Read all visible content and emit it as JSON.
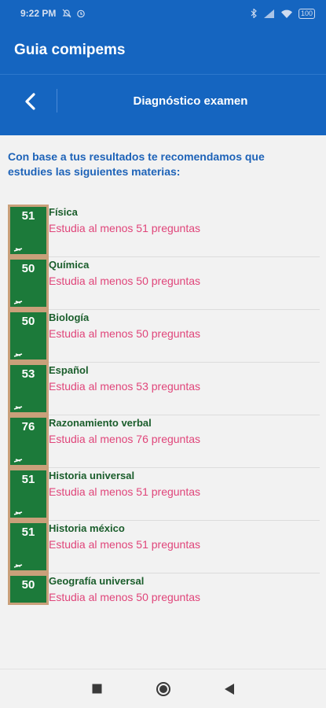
{
  "status": {
    "time": "9:22 PM",
    "battery": "100"
  },
  "app": {
    "title": "Guia comipems"
  },
  "header": {
    "title": "Diagnóstico examen"
  },
  "intro": "Con base a tus resultados te recomendamos que estudies las siguientes materias:",
  "subjects": [
    {
      "count": "51",
      "name": "Física",
      "recommendation": "Estudia al menos 51 preguntas"
    },
    {
      "count": "50",
      "name": "Química",
      "recommendation": "Estudia al menos 50 preguntas"
    },
    {
      "count": "50",
      "name": "Biología",
      "recommendation": "Estudia al menos 50 preguntas"
    },
    {
      "count": "53",
      "name": "Español",
      "recommendation": "Estudia al menos 53 preguntas"
    },
    {
      "count": "76",
      "name": "Razonamiento verbal",
      "recommendation": "Estudia al menos 76 preguntas"
    },
    {
      "count": "51",
      "name": "Historia universal",
      "recommendation": "Estudia al menos 51 preguntas"
    },
    {
      "count": "51",
      "name": "Historia méxico",
      "recommendation": "Estudia al menos 51 preguntas"
    },
    {
      "count": "50",
      "name": "Geografía universal",
      "recommendation": "Estudia al menos 50 preguntas"
    }
  ],
  "colors": {
    "primary": "#1565c0",
    "board": "#1c7a3a",
    "subject_text": "#1a5d2b",
    "recommendation_text": "#e0457a",
    "intro_text": "#1e63b8"
  }
}
